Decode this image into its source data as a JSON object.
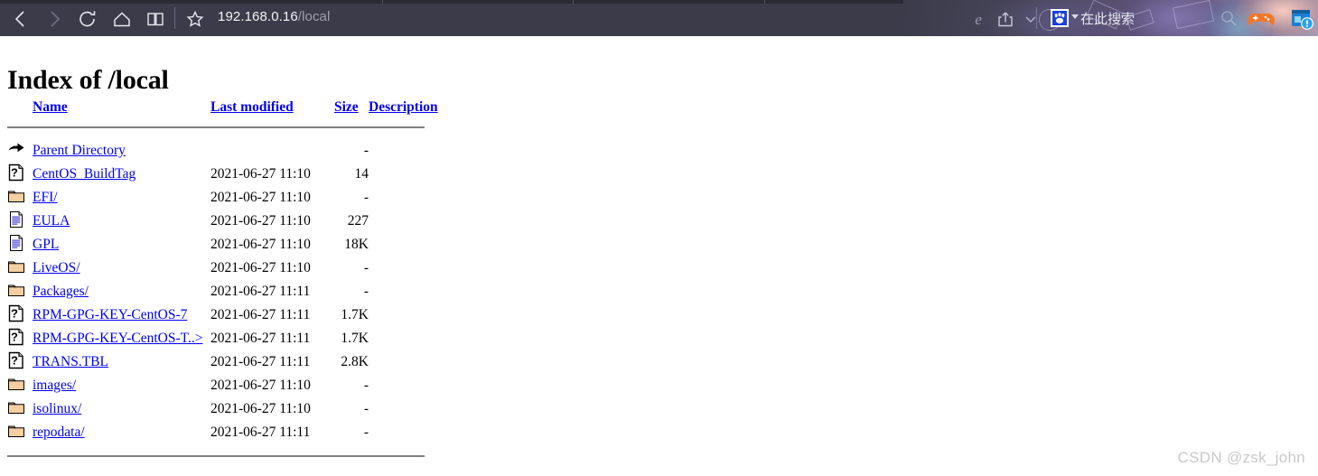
{
  "browser": {
    "url_host": "192.168.0.16",
    "url_path": "/local",
    "nav": {
      "back_label": "Back",
      "forward_label": "Forward",
      "refresh_label": "Refresh",
      "home_label": "Home",
      "reading_view_label": "Reading view",
      "favorites_label": "Add to favorites",
      "edge_label": "Open with Internet Explorer",
      "share_label": "Share",
      "more_label": "More"
    },
    "search": {
      "engine_icon": "baidu-paw-icon",
      "placeholder": "在此搜索"
    },
    "tray": {
      "gamepad_icon": "gamepad-icon",
      "app_icon": "app-alert-icon",
      "search_icon": "search-icon"
    }
  },
  "page": {
    "title": "Index of /local",
    "columns": {
      "icon": "",
      "name": "Name",
      "last_modified": "Last modified",
      "size": "Size",
      "description": "Description"
    },
    "rows": [
      {
        "icon": "parent-directory-icon",
        "name": "Parent Directory",
        "last_modified": "",
        "size": "-",
        "description": ""
      },
      {
        "icon": "unknown-file-icon",
        "name": "CentOS_BuildTag",
        "last_modified": "2021-06-27 11:10",
        "size": "14",
        "description": ""
      },
      {
        "icon": "folder-icon",
        "name": "EFI/",
        "last_modified": "2021-06-27 11:10",
        "size": "-",
        "description": ""
      },
      {
        "icon": "text-file-icon",
        "name": "EULA",
        "last_modified": "2021-06-27 11:10",
        "size": "227",
        "description": ""
      },
      {
        "icon": "text-file-icon",
        "name": "GPL",
        "last_modified": "2021-06-27 11:10",
        "size": "18K",
        "description": ""
      },
      {
        "icon": "folder-icon",
        "name": "LiveOS/",
        "last_modified": "2021-06-27 11:10",
        "size": "-",
        "description": ""
      },
      {
        "icon": "folder-icon",
        "name": "Packages/",
        "last_modified": "2021-06-27 11:11",
        "size": "-",
        "description": ""
      },
      {
        "icon": "unknown-file-icon",
        "name": "RPM-GPG-KEY-CentOS-7",
        "last_modified": "2021-06-27 11:11",
        "size": "1.7K",
        "description": ""
      },
      {
        "icon": "unknown-file-icon",
        "name": "RPM-GPG-KEY-CentOS-T..>",
        "last_modified": "2021-06-27 11:11",
        "size": "1.7K",
        "description": ""
      },
      {
        "icon": "unknown-file-icon",
        "name": "TRANS.TBL",
        "last_modified": "2021-06-27 11:11",
        "size": "2.8K",
        "description": ""
      },
      {
        "icon": "folder-icon",
        "name": "images/",
        "last_modified": "2021-06-27 11:10",
        "size": "-",
        "description": ""
      },
      {
        "icon": "folder-icon",
        "name": "isolinux/",
        "last_modified": "2021-06-27 11:10",
        "size": "-",
        "description": ""
      },
      {
        "icon": "folder-icon",
        "name": "repodata/",
        "last_modified": "2021-06-27 11:11",
        "size": "-",
        "description": ""
      }
    ]
  },
  "watermark": "CSDN @zsk_john",
  "colors": {
    "link": "#0000ee",
    "chrome_bg": "#3b3b4a",
    "folder": "#f5cfa0",
    "rule": "#808080"
  }
}
